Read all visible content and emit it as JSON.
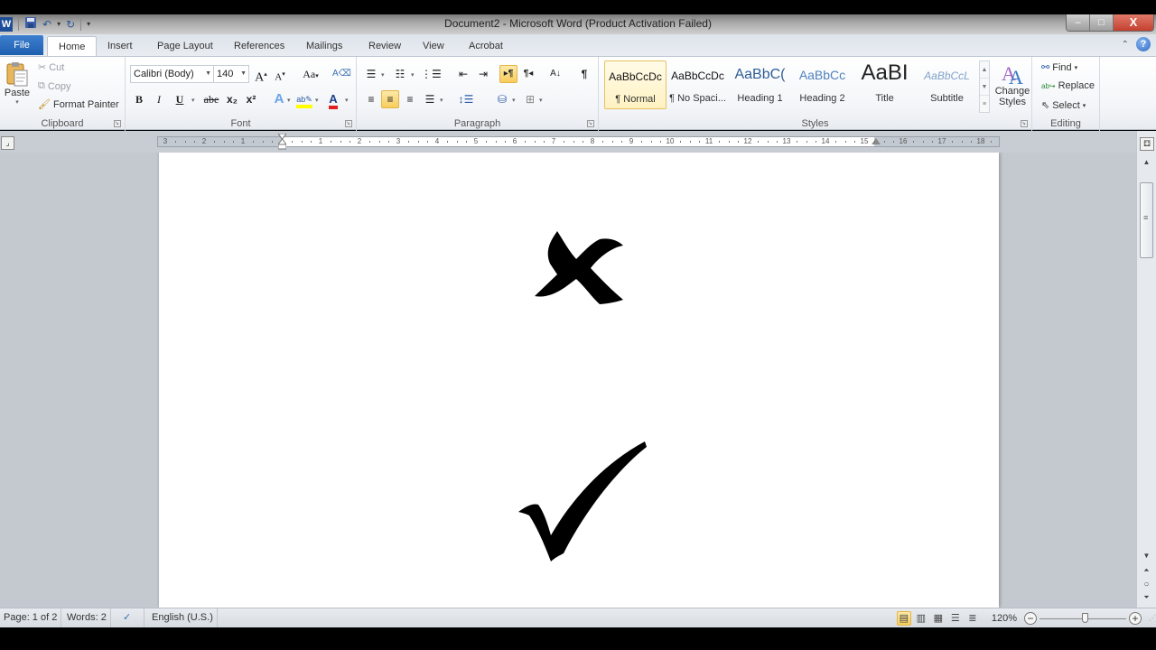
{
  "window": {
    "title": "Document2  -  Microsoft Word (Product Activation Failed)",
    "controls": {
      "minimize": "–",
      "maximize": "□",
      "close": "X"
    }
  },
  "quick_access": {
    "app_icon": "W",
    "save_icon": "floppy-disk",
    "undo": "↶",
    "redo": "↻",
    "customize": "▾"
  },
  "tabs": [
    {
      "label": "File"
    },
    {
      "label": "Home",
      "active": true
    },
    {
      "label": "Insert"
    },
    {
      "label": "Page Layout"
    },
    {
      "label": "References"
    },
    {
      "label": "Mailings"
    },
    {
      "label": "Review"
    },
    {
      "label": "View"
    },
    {
      "label": "Acrobat"
    }
  ],
  "ribbon": {
    "clipboard": {
      "label": "Clipboard",
      "paste": "Paste",
      "cut": "Cut",
      "copy": "Copy",
      "format_painter": "Format Painter"
    },
    "font": {
      "label": "Font",
      "font_name": "Calibri (Body)",
      "font_size": "140",
      "bold": "B",
      "italic": "I",
      "underline": "U",
      "strikethrough": "abe",
      "subscript": "x₂",
      "superscript": "x²",
      "grow": "A",
      "shrink": "A",
      "change_case": "Aa",
      "font_color_hex": "#e02020",
      "highlight_color_hex": "#ffff00"
    },
    "paragraph": {
      "label": "Paragraph",
      "show_marks": "¶",
      "sort": "A↓"
    },
    "styles": {
      "label": "Styles",
      "items": [
        {
          "sample": "AaBbCcDc",
          "name": "¶ Normal",
          "active": true
        },
        {
          "sample": "AaBbCcDc",
          "name": "¶ No Spaci..."
        },
        {
          "sample": "AaBbC(",
          "name": "Heading 1"
        },
        {
          "sample": "AaBbCc",
          "name": "Heading 2"
        },
        {
          "sample": "AaBI",
          "name": "Title"
        },
        {
          "sample": "AaBbCcL",
          "name": "Subtitle"
        }
      ],
      "change_styles": "Change Styles"
    },
    "editing": {
      "label": "Editing",
      "find": "Find",
      "replace": "Replace",
      "select": "Select"
    }
  },
  "ruler": {
    "left_labels": [
      "3",
      "2",
      "1"
    ],
    "right_labels": [
      "1",
      "2",
      "3",
      "4",
      "5",
      "6",
      "7",
      "8",
      "9",
      "10",
      "11",
      "12",
      "13",
      "14",
      "15",
      "16",
      "17",
      "18"
    ]
  },
  "document": {
    "symbols": [
      {
        "name": "cross-mark",
        "glyph": "✘"
      },
      {
        "name": "check-mark",
        "glyph": "✔"
      }
    ]
  },
  "status": {
    "page": "Page: 1 of 2",
    "words": "Words: 2",
    "language": "English (U.S.)",
    "zoom": "120%",
    "zoom_percent": 120
  }
}
